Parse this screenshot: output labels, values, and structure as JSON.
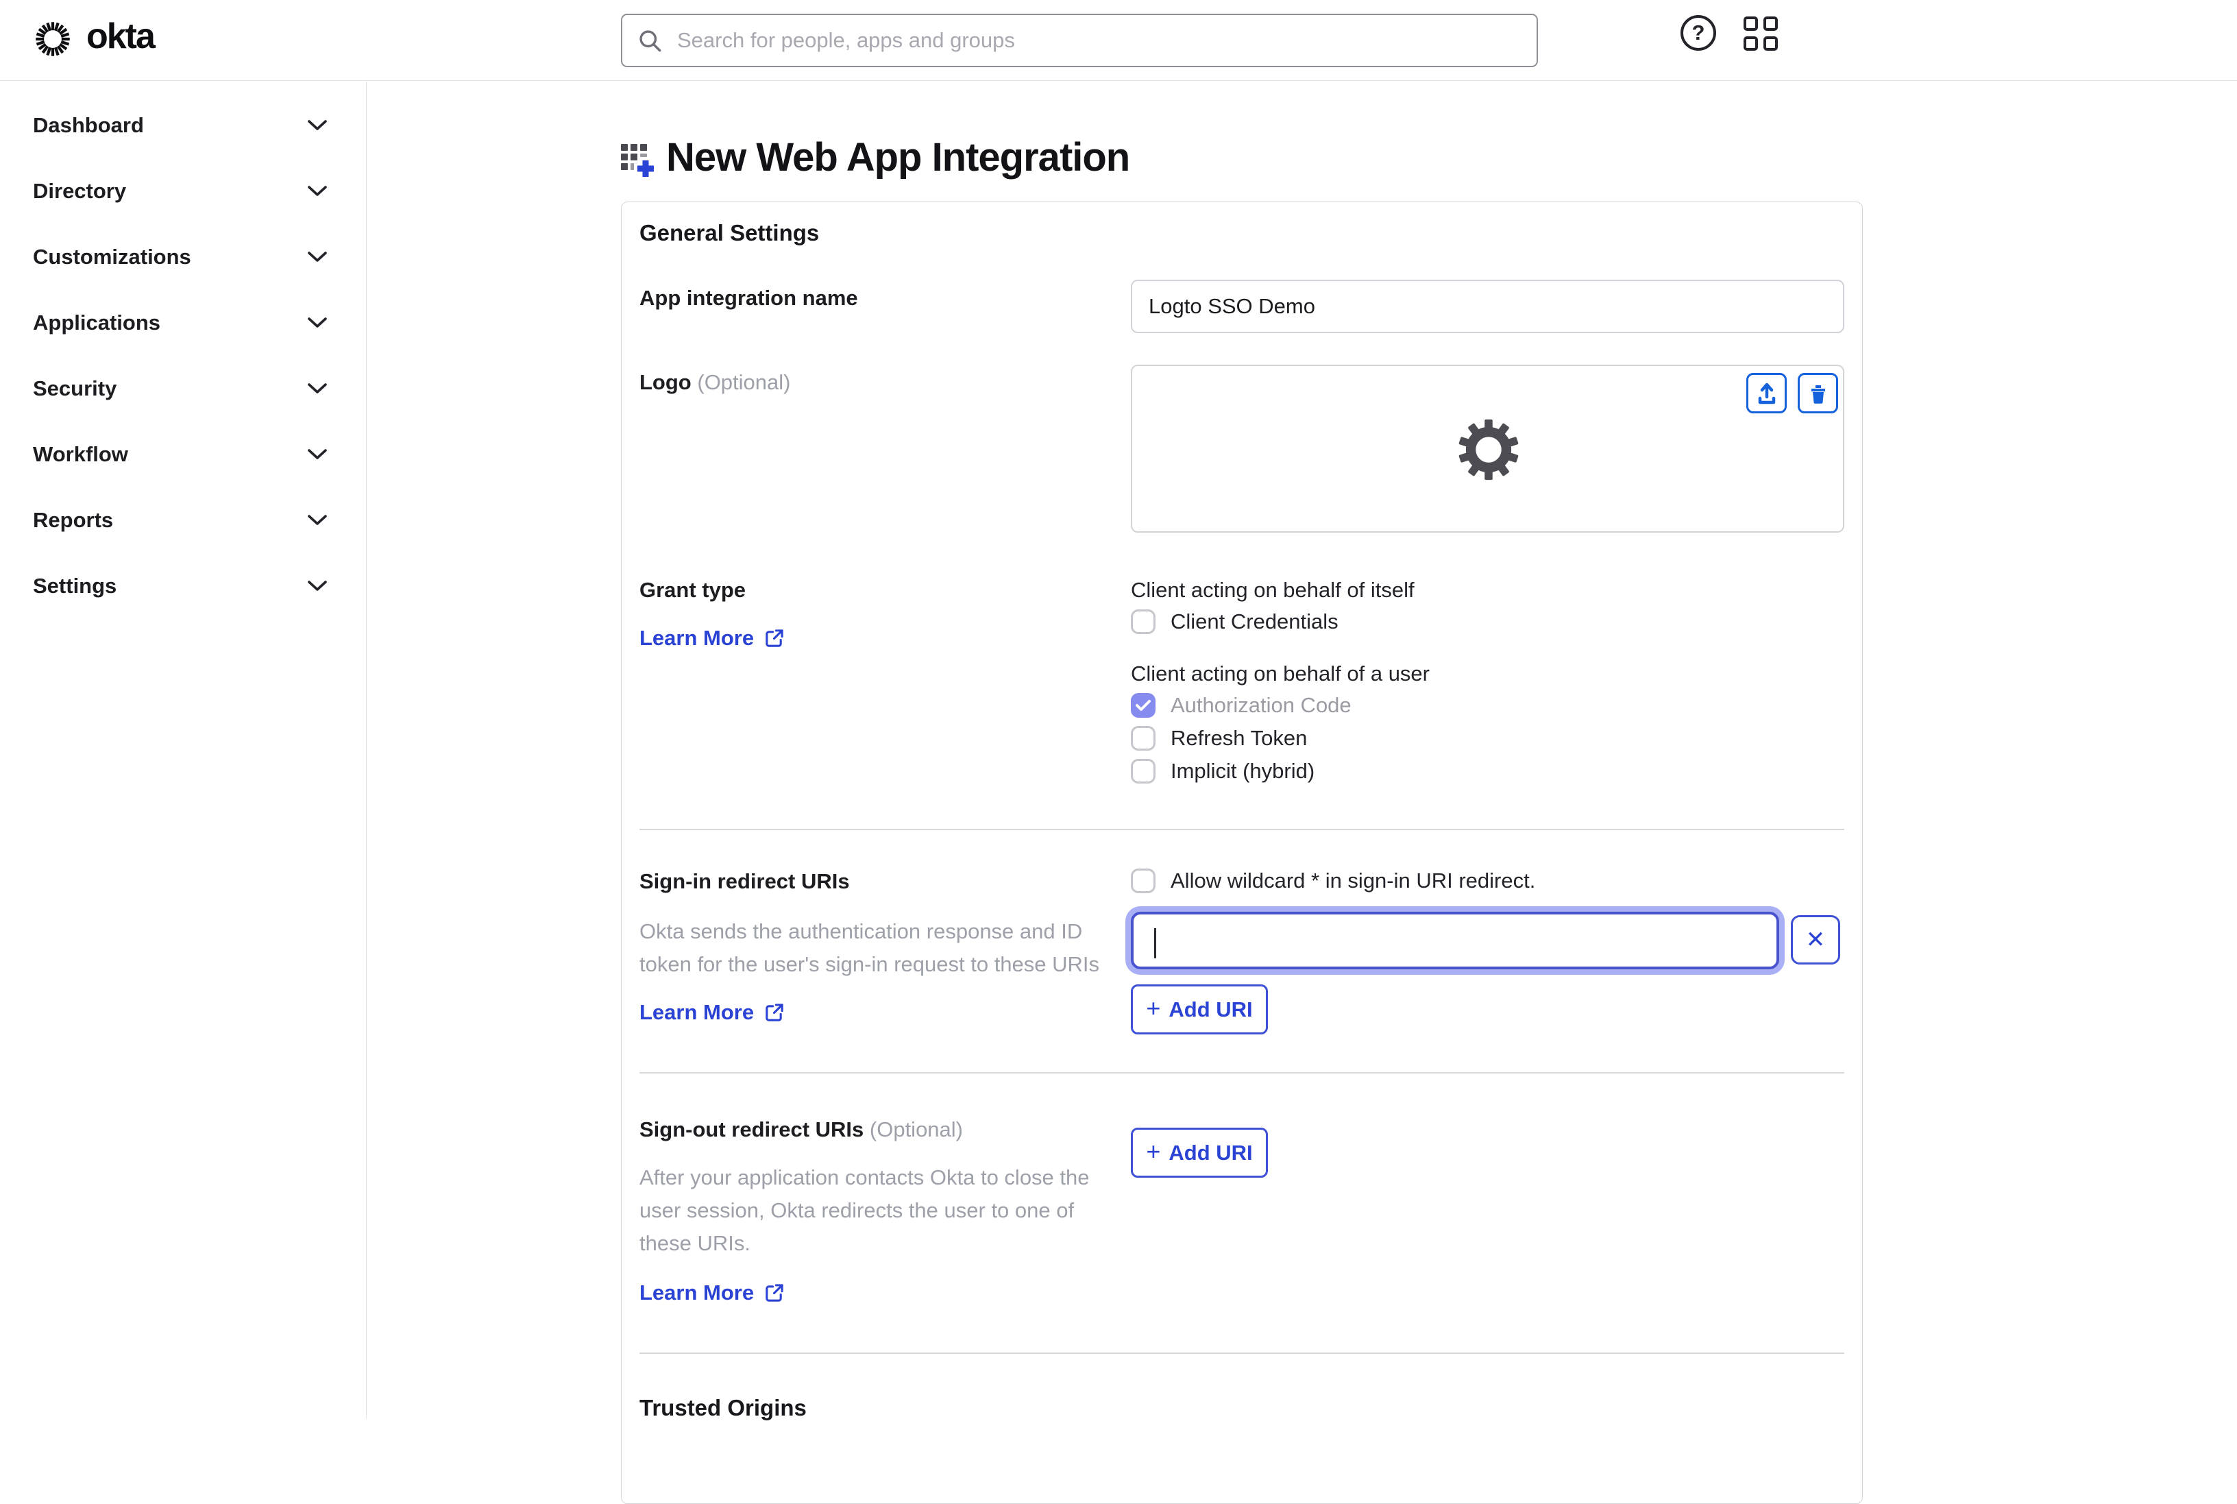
{
  "header": {
    "brand": "okta",
    "search_placeholder": "Search for people, apps and groups"
  },
  "sidebar": {
    "items": [
      {
        "label": "Dashboard"
      },
      {
        "label": "Directory"
      },
      {
        "label": "Customizations"
      },
      {
        "label": "Applications"
      },
      {
        "label": "Security"
      },
      {
        "label": "Workflow"
      },
      {
        "label": "Reports"
      },
      {
        "label": "Settings"
      }
    ]
  },
  "page": {
    "title": "New Web App Integration"
  },
  "general": {
    "heading": "General Settings",
    "app_name": {
      "label": "App integration name",
      "value": "Logto SSO Demo"
    },
    "logo": {
      "label": "Logo",
      "optional": "(Optional)"
    },
    "grant": {
      "label": "Grant type",
      "learn_more": "Learn More",
      "itself_heading": "Client acting on behalf of itself",
      "itself_options": [
        {
          "label": "Client Credentials",
          "checked": false
        }
      ],
      "user_heading": "Client acting on behalf of a user",
      "user_options": [
        {
          "label": "Authorization Code",
          "checked": true
        },
        {
          "label": "Refresh Token",
          "checked": false
        },
        {
          "label": "Implicit (hybrid)",
          "checked": false
        }
      ]
    },
    "signin": {
      "label": "Sign-in redirect URIs",
      "wildcard_label": "Allow wildcard * in sign-in URI redirect.",
      "helper": "Okta sends the authentication response and ID token for the user's sign-in request to these URIs",
      "learn_more": "Learn More",
      "uri_value": "",
      "add_uri": "Add URI"
    },
    "signout": {
      "label": "Sign-out redirect URIs",
      "optional": "(Optional)",
      "helper": "After your application contacts Okta to close the user session, Okta redirects the user to one of these URIs.",
      "learn_more": "Learn More",
      "add_uri": "Add URI"
    },
    "trusted_origins": "Trusted Origins"
  },
  "colors": {
    "link_blue": "#2b43d4",
    "action_blue": "#1662dd",
    "checkbox_checked": "#868bf0",
    "focus_ring": "#8c94f0",
    "text_dark": "#1d1d21",
    "text_muted": "#9da0a8"
  }
}
